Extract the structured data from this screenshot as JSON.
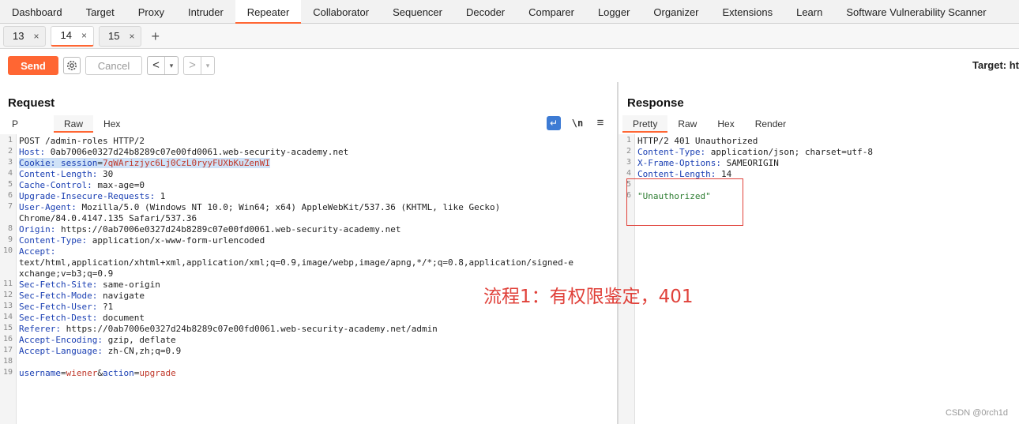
{
  "top_tabs": [
    "Dashboard",
    "Target",
    "Proxy",
    "Intruder",
    "Repeater",
    "Collaborator",
    "Sequencer",
    "Decoder",
    "Comparer",
    "Logger",
    "Organizer",
    "Extensions",
    "Learn",
    "Software Vulnerability Scanner"
  ],
  "active_top_tab": "Repeater",
  "repeater_tabs": [
    {
      "label": "13",
      "close": "×"
    },
    {
      "label": "14",
      "close": "×"
    },
    {
      "label": "15",
      "close": "×"
    }
  ],
  "new_tab": "+",
  "toolbar": {
    "send": "Send",
    "cancel": "Cancel",
    "back": "<",
    "forward": ">",
    "dropdown": "▾",
    "target": "Target: ht"
  },
  "request": {
    "title": "Request",
    "tabs": [
      "P",
      "Raw",
      "Hex"
    ],
    "icons": {
      "wrap": "↵",
      "newline": "\\n",
      "menu": "≡"
    },
    "lines": [
      {
        "n": "1",
        "parts": [
          {
            "t": "POST /admin-roles HTTP/2",
            "c": "v"
          }
        ]
      },
      {
        "n": "2",
        "parts": [
          {
            "t": "Host:",
            "c": "k"
          },
          {
            "t": " 0ab7006e0327d24b8289c07e00fd0061.web-security-academy.net",
            "c": "v"
          }
        ]
      },
      {
        "n": "3",
        "hl": true,
        "parts": [
          {
            "t": "Cookie:",
            "c": "k"
          },
          {
            "t": " session",
            "c": "k"
          },
          {
            "t": "=",
            "c": "v"
          },
          {
            "t": "7qWArizjyc6Lj0CzL0ryyFUXbKuZenWI",
            "c": "r"
          }
        ]
      },
      {
        "n": "4",
        "parts": [
          {
            "t": "Content-Length:",
            "c": "k"
          },
          {
            "t": " 30",
            "c": "v"
          }
        ]
      },
      {
        "n": "5",
        "parts": [
          {
            "t": "Cache-Control:",
            "c": "k"
          },
          {
            "t": " max-age=0",
            "c": "v"
          }
        ]
      },
      {
        "n": "6",
        "parts": [
          {
            "t": "Upgrade-Insecure-Requests:",
            "c": "k"
          },
          {
            "t": " 1",
            "c": "v"
          }
        ]
      },
      {
        "n": "7",
        "parts": [
          {
            "t": "User-Agent:",
            "c": "k"
          },
          {
            "t": " Mozilla/5.0 (Windows NT 10.0; Win64; x64) AppleWebKit/537.36 (KHTML, like Gecko)",
            "c": "v"
          }
        ]
      },
      {
        "n": "",
        "parts": [
          {
            "t": "Chrome/84.0.4147.135 Safari/537.36",
            "c": "v"
          }
        ]
      },
      {
        "n": "8",
        "parts": [
          {
            "t": "Origin:",
            "c": "k"
          },
          {
            "t": " https://0ab7006e0327d24b8289c07e00fd0061.web-security-academy.net",
            "c": "v"
          }
        ]
      },
      {
        "n": "9",
        "parts": [
          {
            "t": "Content-Type:",
            "c": "k"
          },
          {
            "t": " application/x-www-form-urlencoded",
            "c": "v"
          }
        ]
      },
      {
        "n": "10",
        "parts": [
          {
            "t": "Accept:",
            "c": "k"
          }
        ]
      },
      {
        "n": "",
        "parts": [
          {
            "t": "text/html,application/xhtml+xml,application/xml;q=0.9,image/webp,image/apng,*/*;q=0.8,application/signed-e",
            "c": "v"
          }
        ]
      },
      {
        "n": "",
        "parts": [
          {
            "t": "xchange;v=b3;q=0.9",
            "c": "v"
          }
        ]
      },
      {
        "n": "11",
        "parts": [
          {
            "t": "Sec-Fetch-Site:",
            "c": "k"
          },
          {
            "t": " same-origin",
            "c": "v"
          }
        ]
      },
      {
        "n": "12",
        "parts": [
          {
            "t": "Sec-Fetch-Mode:",
            "c": "k"
          },
          {
            "t": " navigate",
            "c": "v"
          }
        ]
      },
      {
        "n": "13",
        "parts": [
          {
            "t": "Sec-Fetch-User:",
            "c": "k"
          },
          {
            "t": " ?1",
            "c": "v"
          }
        ]
      },
      {
        "n": "14",
        "parts": [
          {
            "t": "Sec-Fetch-Dest:",
            "c": "k"
          },
          {
            "t": " document",
            "c": "v"
          }
        ]
      },
      {
        "n": "15",
        "parts": [
          {
            "t": "Referer:",
            "c": "k"
          },
          {
            "t": " https://0ab7006e0327d24b8289c07e00fd0061.web-security-academy.net/admin",
            "c": "v"
          }
        ]
      },
      {
        "n": "16",
        "parts": [
          {
            "t": "Accept-Encoding:",
            "c": "k"
          },
          {
            "t": " gzip, deflate",
            "c": "v"
          }
        ]
      },
      {
        "n": "17",
        "parts": [
          {
            "t": "Accept-Language:",
            "c": "k"
          },
          {
            "t": " zh-CN,zh;q=0.9",
            "c": "v"
          }
        ]
      },
      {
        "n": "18",
        "parts": []
      },
      {
        "n": "19",
        "parts": [
          {
            "t": "username",
            "c": "k"
          },
          {
            "t": "=",
            "c": "v"
          },
          {
            "t": "wiener",
            "c": "r"
          },
          {
            "t": "&",
            "c": "v"
          },
          {
            "t": "action",
            "c": "k"
          },
          {
            "t": "=",
            "c": "v"
          },
          {
            "t": "upgrade",
            "c": "r"
          }
        ]
      }
    ]
  },
  "response": {
    "title": "Response",
    "tabs": [
      "Pretty",
      "Raw",
      "Hex",
      "Render"
    ],
    "lines": [
      {
        "n": "1",
        "parts": [
          {
            "t": "HTTP/2 401 Unauthorized",
            "c": "v"
          }
        ]
      },
      {
        "n": "2",
        "parts": [
          {
            "t": "Content-Type:",
            "c": "k"
          },
          {
            "t": " application/json; charset=utf-8",
            "c": "v"
          }
        ]
      },
      {
        "n": "3",
        "parts": [
          {
            "t": "X-Frame-Options:",
            "c": "k"
          },
          {
            "t": " SAMEORIGIN",
            "c": "v"
          }
        ]
      },
      {
        "n": "4",
        "parts": [
          {
            "t": "Content-Length:",
            "c": "k"
          },
          {
            "t": " 14",
            "c": "v"
          }
        ]
      },
      {
        "n": "5",
        "parts": []
      },
      {
        "n": "6",
        "parts": [
          {
            "t": "\"Unauthorized\"",
            "c": "g"
          }
        ]
      }
    ]
  },
  "annotation": "流程1：有权限鉴定，401",
  "watermark": "CSDN @0rch1d",
  "colors": {
    "accent": "#ff6633",
    "annotation": "#e0413a",
    "header_key": "#1a3fb3",
    "value_red": "#c0392b",
    "json_string": "#2e7d32"
  }
}
